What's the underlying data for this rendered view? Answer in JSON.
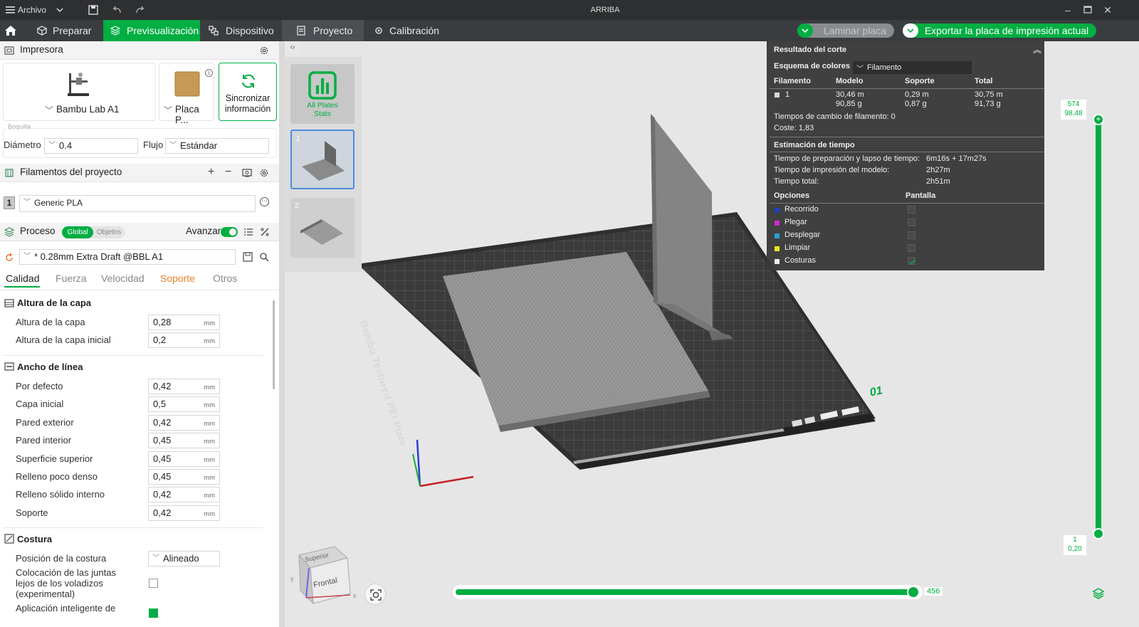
{
  "titlebar": {
    "menu_label": "Archivo",
    "title": "ARRIBA"
  },
  "nav": {
    "tabs": [
      "Preparar",
      "Previsualización",
      "Dispositivo",
      "Proyecto",
      "Calibración"
    ],
    "slice_button": "Laminar placa",
    "export_button": "Exportar la placa de impresión actual"
  },
  "printer": {
    "section_title": "Impresora",
    "printer_name": "Bambu Lab A1",
    "plate_name": "Placa P...",
    "sync_label_1": "Sincronizar",
    "sync_label_2": "información",
    "nozzle_group": "Boquilla",
    "diameter_label": "Diámetro",
    "diameter_value": "0.4",
    "flow_label": "Flujo",
    "flow_value": "Estándar"
  },
  "filaments": {
    "section_title": "Filamentos del proyecto",
    "items": [
      {
        "index": "1",
        "name": "Generic PLA"
      }
    ]
  },
  "process": {
    "section_title": "Proceso",
    "toggle_global": "Global",
    "toggle_objects": "Objetos",
    "advance_label": "Avanzar",
    "profile": "* 0.28mm Extra Draft @BBL A1",
    "tabs": [
      "Calidad",
      "Fuerza",
      "Velocidad",
      "Soporte",
      "Otros"
    ]
  },
  "quality": {
    "layer_height_group": "Altura de la capa",
    "layer_height_label": "Altura de la capa",
    "layer_height_value": "0,28",
    "initial_layer_label": "Altura de la capa inicial",
    "initial_layer_value": "0,2",
    "line_width_group": "Ancho de línea",
    "line_widths": [
      {
        "label": "Por defecto",
        "value": "0,42"
      },
      {
        "label": "Capa inicial",
        "value": "0,5"
      },
      {
        "label": "Pared exterior",
        "value": "0,42"
      },
      {
        "label": "Pared interior",
        "value": "0,45"
      },
      {
        "label": "Superficie superior",
        "value": "0,45"
      },
      {
        "label": "Relleno poco denso",
        "value": "0,45"
      },
      {
        "label": "Relleno sólido interno",
        "value": "0,42"
      },
      {
        "label": "Soporte",
        "value": "0,42"
      }
    ],
    "unit": "mm",
    "seam_group": "Costura",
    "seam_position_label": "Posición de la costura",
    "seam_position_value": "Alineado",
    "seam_gap_label_1": "Colocación de las juntas",
    "seam_gap_label_2": "lejos de los voladizos",
    "seam_gap_label_3": "(experimental)",
    "smart_label": "Aplicación inteligente de"
  },
  "plates": {
    "all_stats_1": "All Plates",
    "all_stats_2": "Stats",
    "plate_1": "1",
    "plate_2": "2"
  },
  "slice_result": {
    "title": "Resultado del corte",
    "color_scheme_label": "Esquema de colores",
    "color_scheme_value": "Filamento",
    "headers": [
      "Filamento",
      "Modelo",
      "Soporte",
      "Total"
    ],
    "row": {
      "filament": "1",
      "model_len": "30,46 m",
      "model_wt": "90,85 g",
      "support_len": "0,29 m",
      "support_wt": "0,87 g",
      "total_len": "30,75 m",
      "total_wt": "91,73 g"
    },
    "filament_changes": "Tiempos de cambio de filamento:  0",
    "cost": "Coste:  1,83",
    "time_title": "Estimación de tiempo",
    "prep_label": "Tiempo de preparación y lapso de tiempo:",
    "prep_value": "6m16s + 17m27s",
    "print_label": "Tiempo de impresión del modelo:",
    "print_value": "2h27m",
    "total_label": "Tiempo total:",
    "total_value": "2h51m",
    "options_header": "Opciones",
    "display_header": "Pantalla",
    "options": [
      {
        "name": "Recorrido",
        "color": "#1f3fbf",
        "checked": false
      },
      {
        "name": "Plegar",
        "color": "#d02ad0",
        "checked": false
      },
      {
        "name": "Desplegar",
        "color": "#2aa0d6",
        "checked": false
      },
      {
        "name": "Limpiar",
        "color": "#e8e81a",
        "checked": false
      },
      {
        "name": "Costuras",
        "color": "#eeeeee",
        "checked": true
      }
    ]
  },
  "layer_slider": {
    "top_layer": "574",
    "top_height": "98,48",
    "bottom_layer": "1",
    "bottom_height": "0,20",
    "top_fraction": 1.0
  },
  "move_slider": {
    "value": "456",
    "fraction": 1.0
  },
  "bed": {
    "label": "Bambu Textured PEI Plate",
    "plate_number": "01"
  },
  "view_cube": {
    "top": "Superior",
    "front": "Frontal"
  },
  "colors": {
    "accent": "#00ae42",
    "dark": "#3a3d40"
  }
}
